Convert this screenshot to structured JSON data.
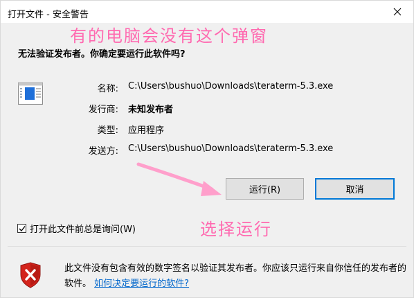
{
  "window": {
    "title": "打开文件 - 安全警告"
  },
  "annotations": {
    "top": "有的电脑会没有这个弹窗",
    "bottom": "选择运行"
  },
  "question": "无法验证发布者。你确定要运行此软件吗?",
  "details": {
    "name_label": "名称:",
    "name_value": "C:\\Users\\bushuo\\Downloads\\teraterm-5.3.exe",
    "publisher_label": "发行商:",
    "publisher_value": "未知发布者",
    "type_label": "类型:",
    "type_value": "应用程序",
    "from_label": "发送方:",
    "from_value": "C:\\Users\\bushuo\\Downloads\\teraterm-5.3.exe"
  },
  "buttons": {
    "run": "运行(R)",
    "cancel": "取消"
  },
  "checkbox": {
    "label": "打开此文件前总是询问(W)",
    "checked": true
  },
  "warning": {
    "text": "此文件没有包含有效的数字签名以验证其发布者。你应该只运行来自你信任的发布者的软件。",
    "link": "如何决定要运行的软件?"
  },
  "colors": {
    "annotation": "#ff6ab0",
    "accent": "#0078d7",
    "link": "#0066cc",
    "shield": "#d4241c"
  },
  "icons": {
    "close": "close-icon",
    "app": "application-icon",
    "shield": "shield-warning-icon",
    "check": "checkmark-icon",
    "arrow": "arrow-annotation"
  }
}
